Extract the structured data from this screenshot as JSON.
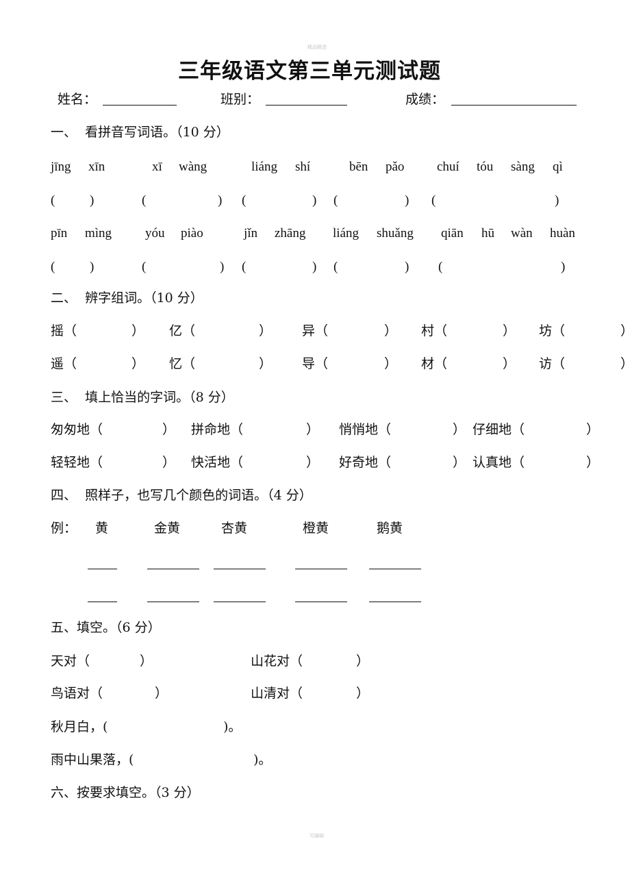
{
  "watermark_top": "精品精选",
  "watermark_bottom": "可编辑",
  "title": "三年级语文第三单元测试题",
  "info": {
    "name_label": "姓名：",
    "class_label": "班别：",
    "score_label": "成绩："
  },
  "s1": {
    "heading": "一、  看拼音写词语。（10 分）",
    "row1": [
      "jīng",
      "xīn",
      "xī",
      "wàng",
      "liáng",
      "shí",
      "bēn",
      "pǎo",
      "chuí",
      "tóu",
      "sàng",
      "qì"
    ],
    "row2": [
      "pīn",
      "mìng",
      "yóu",
      "piào",
      "jǐn",
      "zhāng",
      "liáng",
      "shuǎng",
      "qiān",
      "hū",
      "wàn",
      "huàn"
    ],
    "open": "(",
    "close": ")"
  },
  "s2": {
    "heading": "二、  辨字组词。（10 分）",
    "row1": [
      "摇（",
      "亿（",
      "异（",
      "村（",
      "坊（"
    ],
    "row2": [
      "遥（",
      "忆（",
      "导（",
      "材（",
      "访（"
    ],
    "close": "）"
  },
  "s3": {
    "heading": "三、  填上恰当的字词。（8 分）",
    "row1": [
      "匆匆地（",
      "拼命地（",
      "悄悄地（",
      "仔细地（"
    ],
    "row2": [
      "轻轻地（",
      "快活地（",
      "好奇地（",
      "认真地（"
    ],
    "close": "）"
  },
  "s4": {
    "heading": "四、  照样子，也写几个颜色的词语。（4 分）",
    "example_label": "例：",
    "examples": [
      "黄",
      "金黄",
      "杏黄",
      "橙黄",
      "鹅黄"
    ]
  },
  "s5": {
    "heading": "五、填空。（6 分）",
    "items": [
      "天对（",
      "山花对（",
      "鸟语对（",
      "山清对（"
    ],
    "close": "）",
    "line1_start": "秋月白，(",
    "line1_end": ")。",
    "line2_start": "雨中山果落，(",
    "line2_end": ")。"
  },
  "s6": {
    "heading": "六、按要求填空。（3 分）"
  }
}
